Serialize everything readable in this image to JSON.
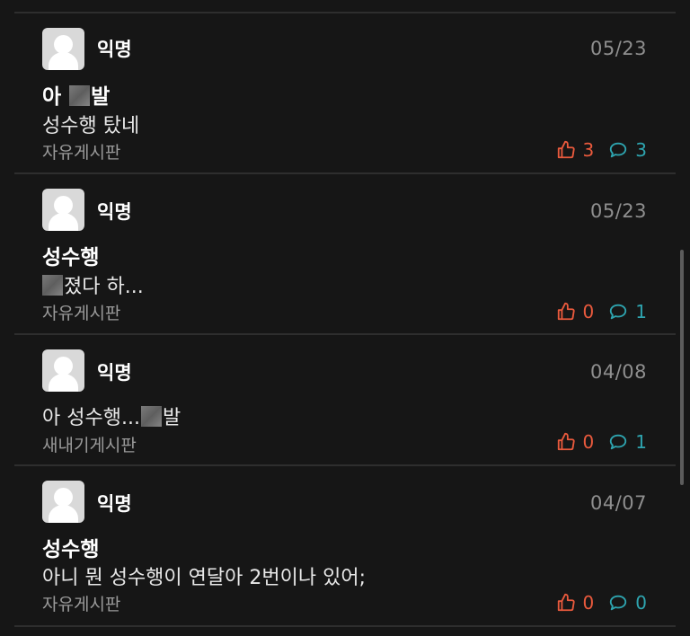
{
  "posts": [
    {
      "author": "익명",
      "date": "05/23",
      "title_parts": [
        "아 ",
        "발"
      ],
      "content": "성수행 탔네",
      "board": "자유게시판",
      "likes": "3",
      "comments": "3"
    },
    {
      "author": "익명",
      "date": "05/23",
      "title": "성수행",
      "content_parts": [
        "",
        "졌다 하..."
      ],
      "board": "자유게시판",
      "likes": "0",
      "comments": "1"
    },
    {
      "author": "익명",
      "date": "04/08",
      "content_parts": [
        "아 성수행...",
        "발"
      ],
      "board": "새내기게시판",
      "likes": "0",
      "comments": "1"
    },
    {
      "author": "익명",
      "date": "04/07",
      "title": "성수행",
      "content": "아니 뭔 성수행이 연달아 2번이나 있어;",
      "board": "자유게시판",
      "likes": "0",
      "comments": "0"
    }
  ],
  "colors": {
    "background": "#161616",
    "like": "#ea5a3d",
    "comment": "#2ea5b0",
    "date": "#8f8f8f",
    "board": "#9a9a9a"
  },
  "icons": {
    "like": "thumbs-up-icon",
    "comment": "speech-bubble-icon",
    "avatar": "default-avatar-icon"
  }
}
